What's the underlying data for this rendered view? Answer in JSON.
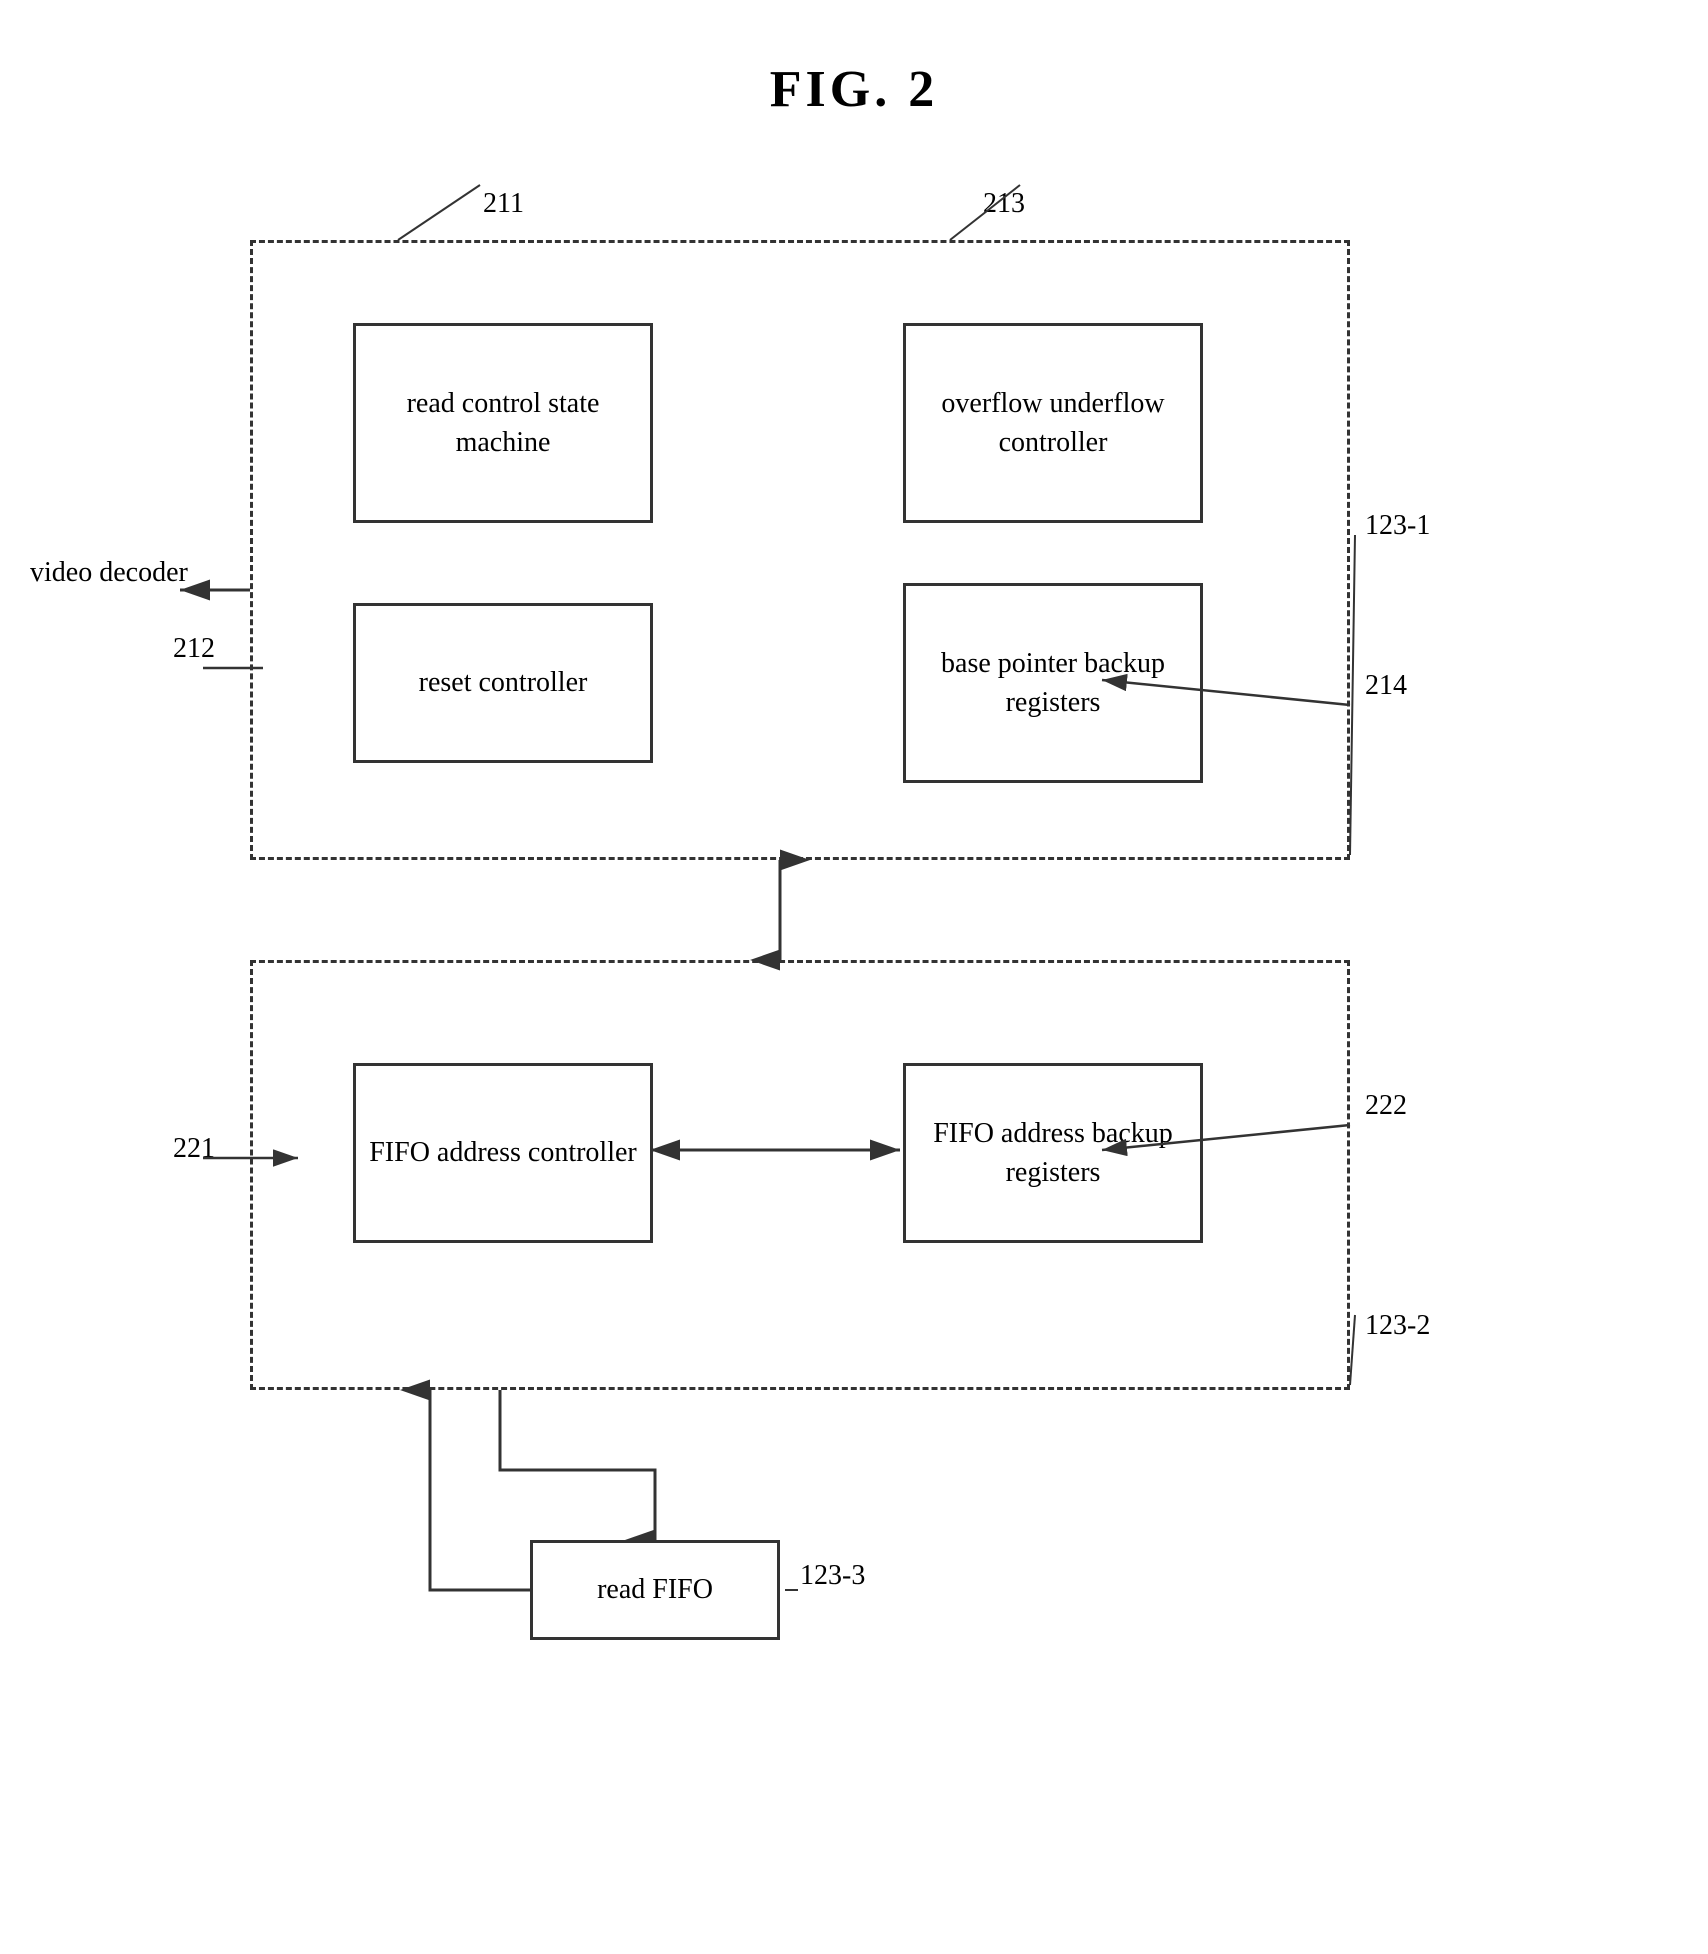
{
  "title": "FIG. 2",
  "labels": {
    "ref_211": "211",
    "ref_212": "212",
    "ref_213": "213",
    "ref_214": "214",
    "ref_221": "221",
    "ref_222": "222",
    "ref_123_1": "123-1",
    "ref_123_2": "123-2",
    "ref_123_3": "123-3",
    "video_decoder": "video\ndecoder"
  },
  "blocks": {
    "read_control": "read control\nstate machine",
    "overflow": "overflow\nunderflow\ncontroller",
    "reset_controller": "reset\ncontroller",
    "base_pointer": "base pointer\nbackup\nregisters",
    "fifo_addr_ctrl": "FIFO address\ncontroller",
    "fifo_addr_backup": "FIFO address\nbackup\nregisters",
    "read_fifo": "read FIFO"
  }
}
